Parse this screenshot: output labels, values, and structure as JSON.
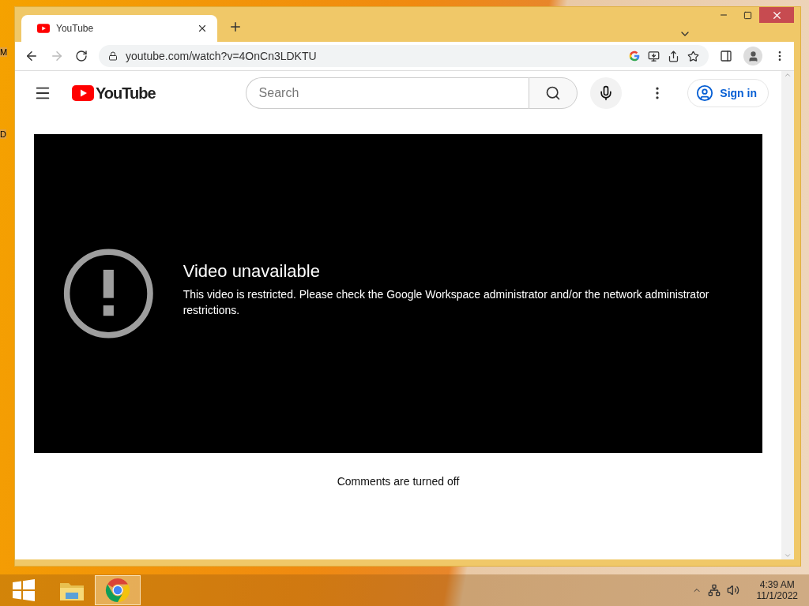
{
  "desktop": {
    "labels": [
      "M",
      "D"
    ]
  },
  "browser": {
    "tabs": [
      {
        "title": "YouTube",
        "selected": true
      }
    ],
    "url": "youtube.com/watch?v=4OnCn3LDKTU"
  },
  "youtube": {
    "logo": "YouTube",
    "search": {
      "placeholder": "Search"
    },
    "sign_in": "Sign in"
  },
  "player": {
    "title": "Video unavailable",
    "message": "This video is restricted. Please check the Google Workspace administrator and/or the network administrator restrictions."
  },
  "comments": "Comments are turned off",
  "taskbar": {
    "apps": [
      {
        "kind": "files",
        "selected": false
      },
      {
        "kind": "chrome",
        "selected": true
      }
    ],
    "time": "4:39 AM",
    "date": "11/1/2022"
  }
}
